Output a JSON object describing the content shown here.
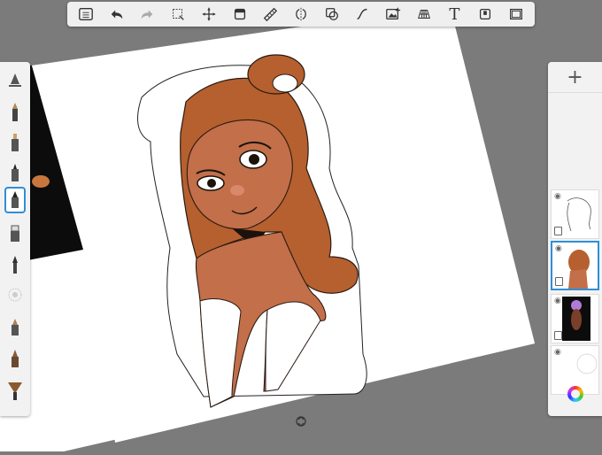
{
  "app": {
    "accent_color": "#2e8fd8",
    "background_color": "#7b7b7b"
  },
  "toolbar": {
    "tools": [
      {
        "name": "layer-list-icon",
        "active": false
      },
      {
        "name": "undo-icon",
        "active": false
      },
      {
        "name": "redo-icon",
        "active": false
      },
      {
        "name": "selection-icon",
        "active": false
      },
      {
        "name": "transform-icon",
        "active": false
      },
      {
        "name": "crop-icon",
        "active": false
      },
      {
        "name": "ruler-icon",
        "active": false
      },
      {
        "name": "symmetry-icon",
        "active": false
      },
      {
        "name": "shapes-icon",
        "active": false
      },
      {
        "name": "curve-icon",
        "active": false
      },
      {
        "name": "image-import-icon",
        "active": false
      },
      {
        "name": "perspective-grid-icon",
        "active": false
      },
      {
        "name": "text-icon",
        "active": false
      },
      {
        "name": "color-fill-icon",
        "active": false
      },
      {
        "name": "fullscreen-icon",
        "active": false
      }
    ],
    "text_tool_glyph": "T"
  },
  "brushes": [
    {
      "name": "ruler-brush-icon",
      "selected": false
    },
    {
      "name": "pencil-icon",
      "selected": false
    },
    {
      "name": "marker-icon",
      "selected": false
    },
    {
      "name": "felt-pen-icon",
      "selected": false
    },
    {
      "name": "ballpoint-pen-icon",
      "selected": true
    },
    {
      "name": "paint-brush-icon",
      "selected": false
    },
    {
      "name": "airbrush-icon",
      "selected": false
    },
    {
      "name": "smudge-icon",
      "selected": false
    },
    {
      "name": "blender-icon",
      "selected": false
    },
    {
      "name": "chalk-icon",
      "selected": false
    },
    {
      "name": "fan-brush-icon",
      "selected": false
    }
  ],
  "layers": {
    "add_label": "+",
    "items": [
      {
        "name": "lineart",
        "visible": true,
        "active": false
      },
      {
        "name": "color",
        "visible": true,
        "active": true
      },
      {
        "name": "reference",
        "visible": true,
        "active": false
      },
      {
        "name": "background",
        "visible": true,
        "active": false
      }
    ]
  }
}
